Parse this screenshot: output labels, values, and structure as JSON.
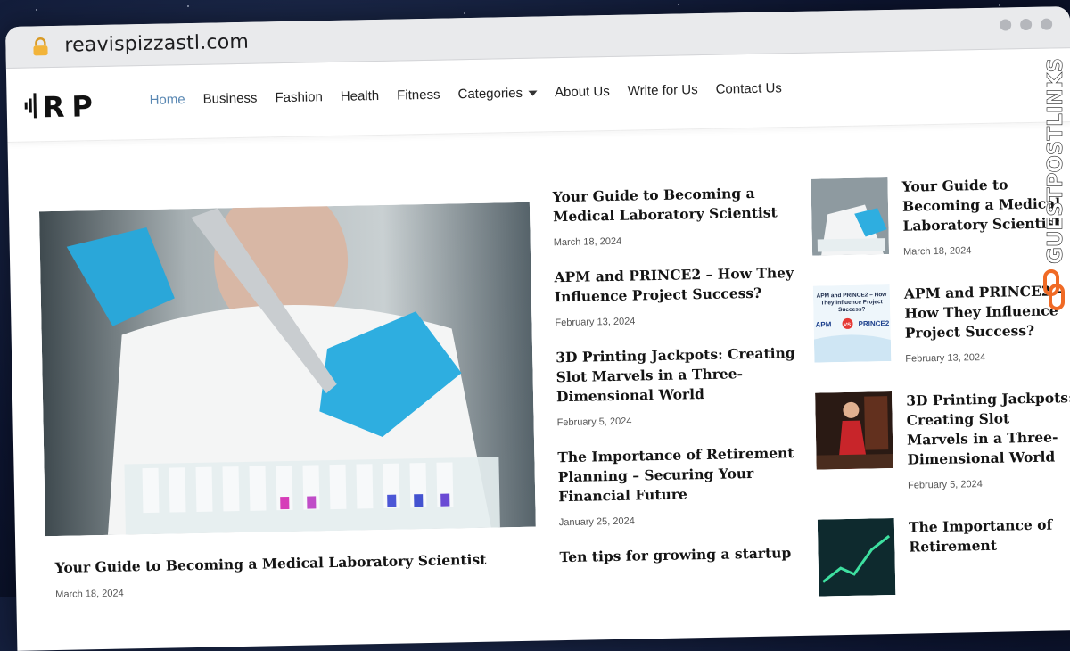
{
  "browser": {
    "url": "reavispizzastl.com"
  },
  "site": {
    "logo_text": "RP"
  },
  "nav": {
    "items": [
      "Home",
      "Business",
      "Fashion",
      "Health",
      "Fitness",
      "Categories",
      "About Us",
      "Write for Us",
      "Contact Us"
    ],
    "active": "Home"
  },
  "featured": {
    "title": "Your Guide to Becoming a Medical Laboratory Scientist",
    "date": "March 18, 2024"
  },
  "middle_posts": [
    {
      "title": "Your Guide to Becoming a Medical Laboratory Scientist",
      "date": "March 18, 2024"
    },
    {
      "title": "APM and PRINCE2 – How They Influence Project Success?",
      "date": "February 13, 2024"
    },
    {
      "title": "3D Printing Jackpots: Creating Slot Marvels in a Three-Dimensional World",
      "date": "February 5, 2024"
    },
    {
      "title": "The Importance of Retirement Planning – Securing Your Financial Future",
      "date": "January 25, 2024"
    },
    {
      "title": "Ten tips for growing a startup",
      "date": ""
    }
  ],
  "right_posts": [
    {
      "title": "Your Guide to Becoming a Medical Laboratory Scientist",
      "date": "March 18, 2024"
    },
    {
      "title": "APM and PRINCE2 – How They Influence Project Success?",
      "date": "February 13, 2024",
      "thumb_text": {
        "heading": "APM and PRINCE2 – How They Influence Project Success?",
        "left": "APM",
        "vs": "VS",
        "right": "PRINCE2"
      }
    },
    {
      "title": "3D Printing Jackpots: Creating Slot Marvels in a Three-Dimensional World",
      "date": "February 5, 2024"
    },
    {
      "title": "The Importance of Retirement",
      "date": ""
    }
  ],
  "watermark": {
    "text": "GUESTPOSTLINKS"
  },
  "colors": {
    "nav_active": "#5a88b3",
    "watermark": "#f06a25"
  }
}
